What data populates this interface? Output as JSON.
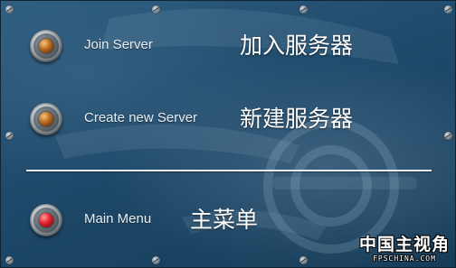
{
  "menu": {
    "items": [
      {
        "label_en": "Join Server",
        "label_cn": "加入服务器",
        "indicator": "amber"
      },
      {
        "label_en": "Create new Server",
        "label_cn": "新建服务器",
        "indicator": "amber"
      },
      {
        "label_en": "Main Menu",
        "label_cn": "主菜单",
        "indicator": "red"
      }
    ]
  },
  "watermark": {
    "cn": "中国主视角",
    "en": "FPSCHINA.COM"
  },
  "colors": {
    "background": "#1f4a6b",
    "text": "#e8eef2",
    "divider": "#e9eef2",
    "indicator_amber": "#b76a1d",
    "indicator_red": "#e0202a"
  },
  "icons": {
    "menu_knob": "metal-knob-icon",
    "rivet": "rivet-icon"
  }
}
